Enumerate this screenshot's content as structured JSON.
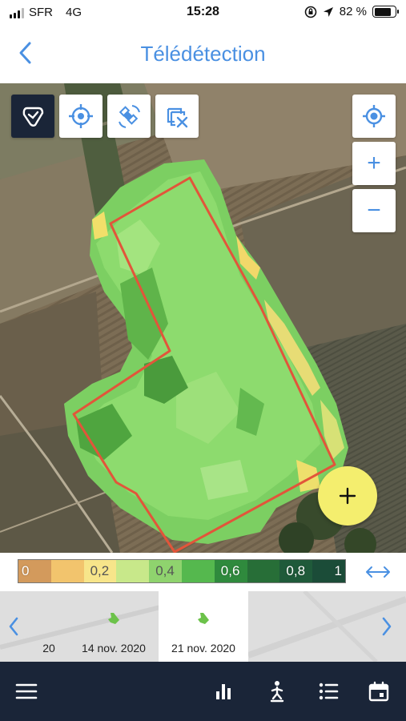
{
  "status_bar": {
    "carrier": "SFR",
    "network": "4G",
    "time": "15:28",
    "battery_percent": 82,
    "battery_label": "82 %"
  },
  "header": {
    "title": "Télédétection",
    "back_icon": "chevron-left-icon"
  },
  "map": {
    "tools": [
      {
        "name": "field-boundary-tool",
        "icon": "field-draw-icon",
        "active": true
      },
      {
        "name": "target-tool",
        "icon": "crosshair-icon",
        "active": false
      },
      {
        "name": "satellite-tool",
        "icon": "satellite-icon",
        "active": false
      },
      {
        "name": "clear-selection-tool",
        "icon": "clear-layers-icon",
        "active": false
      }
    ],
    "zoom_controls": {
      "locate_icon": "locate-icon",
      "zoom_in": "+",
      "zoom_out": "−"
    },
    "fab_label": "+"
  },
  "legend": {
    "labels": [
      "0",
      "0,2",
      "0,4",
      "0,6",
      "0,8",
      "1"
    ],
    "colors": [
      "#d39a5c",
      "#f2c46d",
      "#f7e58a",
      "#c8e88a",
      "#8fd36e",
      "#55b84e",
      "#2f8a3d",
      "#276e37",
      "#1f5a3a",
      "#1b4c38"
    ],
    "expand_icon": "double-arrow-horizontal-icon"
  },
  "carousel": {
    "dates": [
      {
        "label": "20",
        "selected": false
      },
      {
        "label": "14 nov. 2020",
        "selected": false
      },
      {
        "label": "21 nov. 2020",
        "selected": true
      }
    ],
    "prev_icon": "chevron-left-icon",
    "next_icon": "chevron-right-icon"
  },
  "bottom_nav": {
    "items": [
      {
        "name": "menu",
        "icon": "hamburger-menu-icon"
      },
      {
        "name": "statistics",
        "icon": "bar-chart-icon"
      },
      {
        "name": "field-visit",
        "icon": "walking-person-icon"
      },
      {
        "name": "list",
        "icon": "list-icon"
      },
      {
        "name": "calendar",
        "icon": "calendar-icon"
      }
    ]
  },
  "colors": {
    "accent": "#4a90e2",
    "dark_nav": "#1a2538",
    "field_outline": "#e2553a",
    "fab": "#f4ee6e"
  }
}
